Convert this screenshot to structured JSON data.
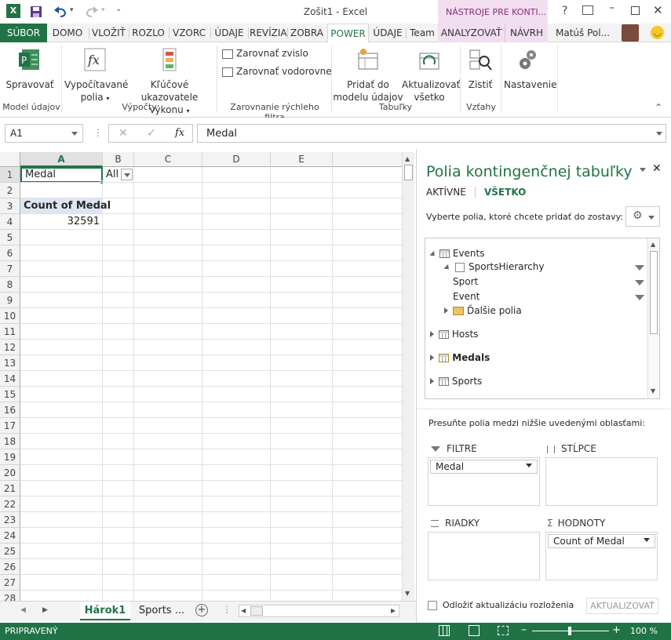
{
  "window": {
    "title": "Zošit1 - Excel",
    "context_title": "NÁSTROJE PRE KONTI...",
    "help": "?",
    "user": "Matúš Pol..."
  },
  "tabs": [
    "SÚBOR",
    "DOMO",
    "VLOŽIŤ",
    "ROZLO",
    "VZORC",
    "ÚDAJE",
    "REVÍZIA",
    "ZOBRA",
    "POWER",
    "ÚDAJE",
    "Team",
    "ANALYZOVAŤ",
    "NÁVRH"
  ],
  "ribbon": {
    "manage": "Spravovať",
    "calc_fields_1": "Vypočítavané",
    "calc_fields_2": "polia",
    "kpi_1": "Kľúčové ukazovatele",
    "kpi_2": "výkonu",
    "align_v": "Zarovnať zvislo",
    "align_h": "Zarovnať vodorovne",
    "add_model_1": "Pridať do",
    "add_model_2": "modelu údajov",
    "update_all_1": "Aktualizovať",
    "update_all_2": "všetko",
    "detect": "Zistiť",
    "settings": "Nastavenie",
    "groups": {
      "model": "Model údajov",
      "calcs": "Výpočty",
      "align": "Zarovnanie rýchleho filtra",
      "tables": "Tabuľky",
      "relations": "Vzťahy"
    }
  },
  "formula_bar": {
    "name_box": "A1",
    "fx": "fx",
    "formula": "Medal"
  },
  "grid": {
    "columns": [
      "A",
      "B",
      "C",
      "D",
      "E"
    ],
    "rows": [
      "1",
      "2",
      "3",
      "4",
      "5",
      "6",
      "7",
      "8",
      "9",
      "10",
      "11",
      "12",
      "13",
      "14",
      "15",
      "16",
      "17",
      "18",
      "19",
      "20",
      "21",
      "22",
      "23",
      "24",
      "25",
      "26",
      "27",
      "28"
    ],
    "cells": {
      "A1": "Medal",
      "B1": "All",
      "A3": "Count of Medal",
      "A4": "32591"
    }
  },
  "sheets": {
    "active": "Hárok1",
    "other": "Sports ..."
  },
  "status": {
    "ready": "PRIPRAVENÝ",
    "zoom": "100 %"
  },
  "pivot_pane": {
    "title": "Polia kontingenčnej tabuľky",
    "tab_active": "AKTÍVNE",
    "tab_all": "VŠETKO",
    "instruction": "Vyberte polia, ktoré chcete pridať do zostavy:",
    "fields": {
      "events": "Events",
      "sports_hierarchy": "SportsHierarchy",
      "sport": "Sport",
      "event": "Event",
      "more_fields": "Ďalšie polia",
      "hosts": "Hosts",
      "medals": "Medals",
      "sports": "Sports"
    },
    "drag_instruction": "Presuňte polia medzi nižšie uvedenými oblasťami:",
    "zones": {
      "filters": "FILTRE",
      "columns": "STĹPCE",
      "rows": "RIADKY",
      "values": "HODNOTY",
      "filter_item": "Medal",
      "value_item": "Count of Medal"
    },
    "defer_label": "Odložiť aktualizáciu rozloženia",
    "update_button": "AKTUALIZOVAŤ"
  },
  "colors": {
    "excel_green": "#217346",
    "context_pink": "#f1dfef"
  }
}
